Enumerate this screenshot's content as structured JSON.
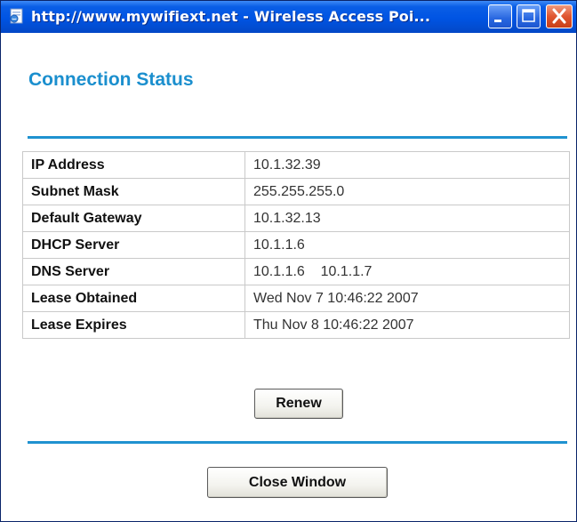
{
  "window": {
    "title": "http://www.mywifiext.net - Wireless Access Poi...",
    "controls": {
      "minimize_icon": "minimize-icon",
      "maximize_icon": "maximize-icon",
      "close_icon": "close-icon"
    },
    "colors": {
      "titlebar": "#0054e3",
      "close_button": "#e0552f"
    }
  },
  "page": {
    "heading": "Connection Status",
    "accent_color": "#1f92d0"
  },
  "table": {
    "rows": [
      {
        "label": "IP Address",
        "value": "10.1.32.39"
      },
      {
        "label": "Subnet Mask",
        "value": "255.255.255.0"
      },
      {
        "label": "Default Gateway",
        "value": "10.1.32.13"
      },
      {
        "label": "DHCP Server",
        "value": "10.1.1.6"
      },
      {
        "label": "DNS Server",
        "value": "10.1.1.6    10.1.1.7"
      },
      {
        "label": "Lease Obtained",
        "value": "Wed Nov 7 10:46:22 2007"
      },
      {
        "label": "Lease Expires",
        "value": "Thu Nov 8 10:46:22 2007"
      }
    ]
  },
  "buttons": {
    "renew": "Renew",
    "close_window": "Close Window"
  }
}
